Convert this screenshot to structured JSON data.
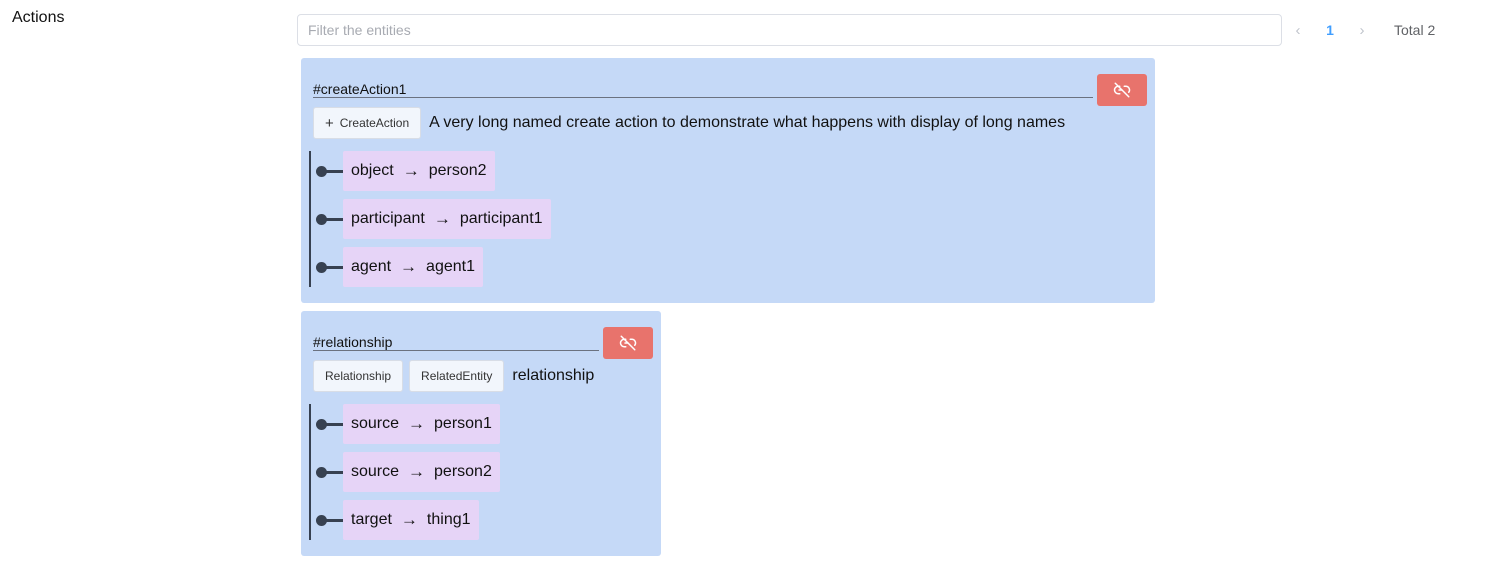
{
  "section": {
    "title": "Actions"
  },
  "filter": {
    "placeholder": "Filter the entities"
  },
  "pagination": {
    "prev": "‹",
    "current": "1",
    "next": "›",
    "total": "Total 2"
  },
  "colors": {
    "card": "#c5d9f7",
    "chip": "#e6d4f7",
    "unlink": "#e8736c",
    "accent": "#409eff"
  },
  "cards": [
    {
      "id": "#createAction1",
      "type_buttons": [
        {
          "icon": "plus-icon",
          "label": "CreateAction"
        }
      ],
      "label": "A very long named create action to demonstrate what happens with display of long names",
      "relations": [
        {
          "role": "object",
          "target": "person2"
        },
        {
          "role": "participant",
          "target": "participant1"
        },
        {
          "role": "agent",
          "target": "agent1"
        }
      ]
    },
    {
      "id": "#relationship",
      "type_buttons": [
        {
          "label": "Relationship"
        },
        {
          "label": "RelatedEntity"
        }
      ],
      "label": "relationship",
      "relations": [
        {
          "role": "source",
          "target": "person1"
        },
        {
          "role": "source",
          "target": "person2"
        },
        {
          "role": "target",
          "target": "thing1"
        }
      ]
    }
  ]
}
